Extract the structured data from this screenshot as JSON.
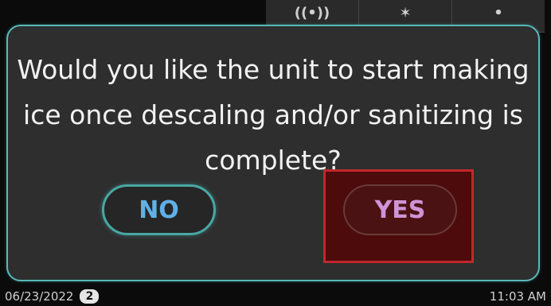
{
  "top_tabs": [
    {
      "icon": "wireless-signal-icon",
      "glyph": "((•))"
    },
    {
      "icon": "fan-icon",
      "glyph": "✶"
    },
    {
      "icon": "person-icon",
      "glyph": "•"
    }
  ],
  "dialog": {
    "question": "Would you like the unit to start making ice once descaling and/or sanitizing is complete?",
    "no_label": "NO",
    "yes_label": "YES"
  },
  "status": {
    "date": "06/23/2022",
    "badge_count": "2",
    "time": "11:03 AM"
  },
  "colors": {
    "dialog_border": "#59b8b8",
    "no_text": "#5fb0e6",
    "yes_text": "#cf93d6",
    "highlight_border": "#c1272d"
  }
}
